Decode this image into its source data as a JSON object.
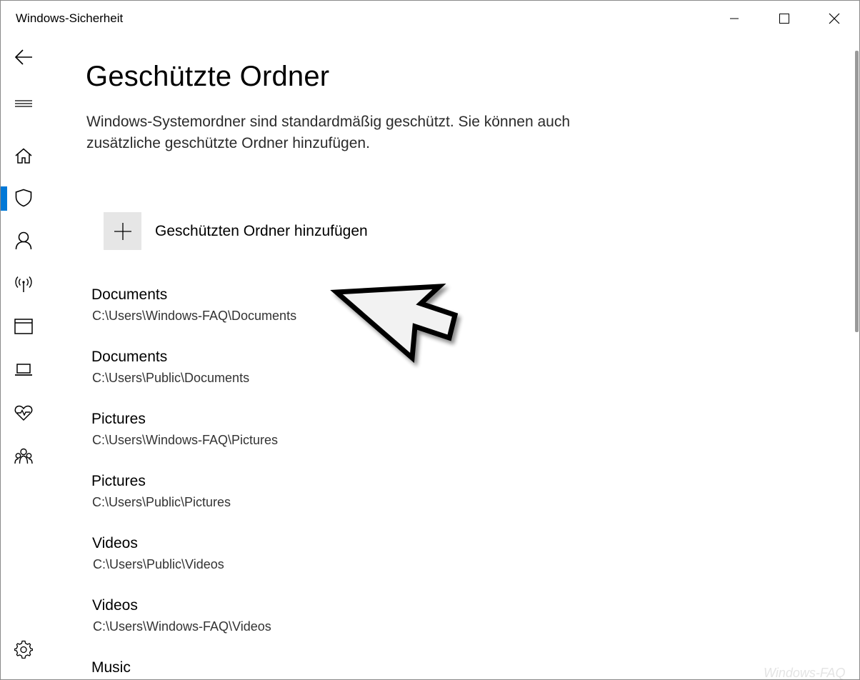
{
  "window": {
    "title": "Windows-Sicherheit"
  },
  "nav": {
    "items": [
      {
        "icon": "back-arrow-icon"
      },
      {
        "icon": "hamburger-icon"
      },
      {
        "icon": "home-icon"
      },
      {
        "icon": "shield-icon",
        "active": true
      },
      {
        "icon": "account-icon"
      },
      {
        "icon": "wireless-icon"
      },
      {
        "icon": "app-browser-icon"
      },
      {
        "icon": "laptop-icon"
      },
      {
        "icon": "heart-health-icon"
      },
      {
        "icon": "family-icon"
      },
      {
        "icon": "gear-icon"
      }
    ]
  },
  "main": {
    "title": "Geschützte Ordner",
    "description": "Windows-Systemordner sind standardmäßig geschützt. Sie können auch zusätzliche geschützte Ordner hinzufügen.",
    "add_button_label": "Geschützten Ordner hinzufügen",
    "folders": [
      {
        "name": "Documents",
        "path": "C:\\Users\\Windows-FAQ\\Documents"
      },
      {
        "name": "Documents",
        "path": "C:\\Users\\Public\\Documents"
      },
      {
        "name": "Pictures",
        "path": "C:\\Users\\Windows-FAQ\\Pictures"
      },
      {
        "name": "Pictures",
        "path": "C:\\Users\\Public\\Pictures"
      },
      {
        "name": "Videos",
        "path": "C:\\Users\\Public\\Videos"
      },
      {
        "name": "Videos",
        "path": "C:\\Users\\Windows-FAQ\\Videos"
      },
      {
        "name": "Music",
        "path": ""
      }
    ]
  },
  "watermark": "Windows-FAQ",
  "colors": {
    "accent": "#0078d7",
    "add_button_bg": "#e6e6e6"
  }
}
